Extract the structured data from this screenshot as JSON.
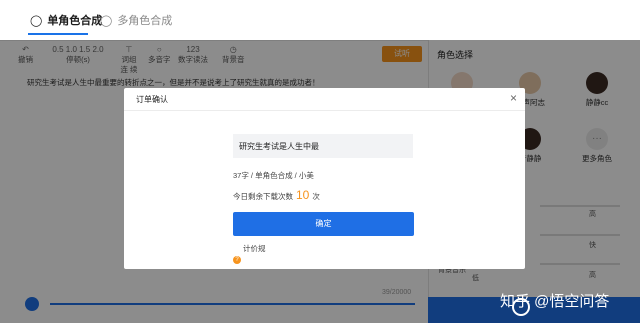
{
  "tabs": [
    {
      "label": "单角色合成",
      "icon": "user-icon"
    },
    {
      "label": "多角色合成",
      "icon": "users-icon"
    }
  ],
  "toolbar": {
    "undo": "撤销",
    "pause_values": "0.5  1.0  1.5  2.0",
    "pause_label": "停顿(s)",
    "continuous": "词组连\n续",
    "polyphone": "多音字",
    "number": "数字读法",
    "bgm": "背景音",
    "trial": "试听"
  },
  "editor": {
    "text": "研究生考试是人生中最重要的转折点之一，但是并不是说考上了研究生就真的是成功者！",
    "char_count": "39/20000"
  },
  "right_panel": {
    "title": "角色选择",
    "roles": [
      {
        "name": "男声阿志"
      },
      {
        "name": "静静cc"
      },
      {
        "name": "音静静"
      },
      {
        "name": "更多角色"
      }
    ],
    "slider_labels": [
      "高",
      "快",
      "高",
      "背景音乐",
      "低"
    ]
  },
  "modal": {
    "title": "订单确认",
    "close": "×",
    "text_value": "研究生考试是人生中最",
    "summary": "37字 / 单角色合成 / 小美",
    "remaining_prefix": "今日剩余下载次数",
    "remaining_count": "10",
    "remaining_suffix": "次",
    "confirm": "确定",
    "pricing": "计价规"
  },
  "watermark": "知乎 @悟空问答",
  "progress_fraction": 1.0
}
